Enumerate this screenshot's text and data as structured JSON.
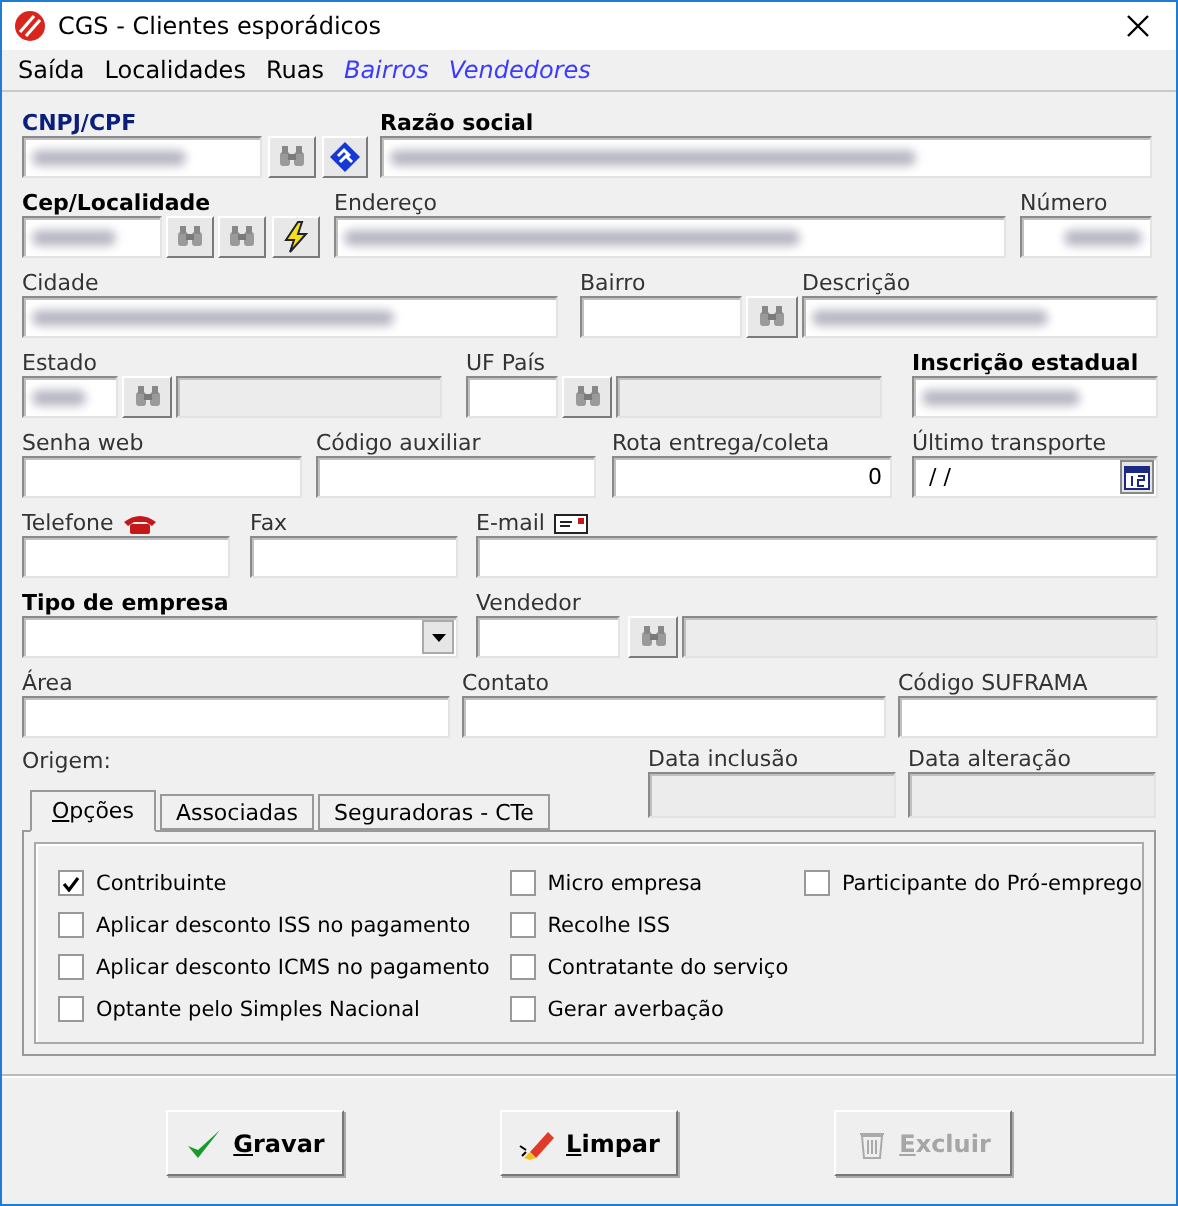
{
  "window": {
    "title": "CGS - Clientes esporádicos"
  },
  "menu": [
    {
      "label": "Saída",
      "kind": "menu"
    },
    {
      "label": "Localidades",
      "kind": "menu"
    },
    {
      "label": "Ruas",
      "kind": "menu"
    },
    {
      "label": "Bairros",
      "kind": "link"
    },
    {
      "label": "Vendedores",
      "kind": "link"
    }
  ],
  "rows": [
    [
      {
        "kind": "field",
        "label": "CNPJ/CPF",
        "bold": true,
        "highlighted": true,
        "blurred": true
      },
      {
        "kind": "lookup"
      },
      {
        "kind": "web"
      },
      {
        "kind": "field",
        "label": "Razão social",
        "bold": true,
        "blurred": true
      }
    ],
    [
      {
        "kind": "field",
        "label": "Cep/Localidade",
        "bold": true,
        "blurred": true
      },
      {
        "kind": "lookup"
      },
      {
        "kind": "lookup"
      },
      {
        "kind": "lightning"
      },
      {
        "kind": "field",
        "label": "Endereço",
        "blurred": true
      },
      {
        "kind": "field",
        "label": "Número",
        "blurred": true,
        "right_aligned": true
      }
    ],
    [
      {
        "kind": "field",
        "label": "Cidade",
        "blurred": true
      },
      {
        "kind": "field",
        "label": "Bairro"
      },
      {
        "kind": "lookup"
      },
      {
        "kind": "field",
        "label": "Descrição",
        "blurred": true
      }
    ],
    [
      {
        "kind": "field",
        "label": "Estado",
        "blurred": true
      },
      {
        "kind": "lookup"
      },
      {
        "kind": "field",
        "disabled": true
      },
      {
        "kind": "field",
        "label": "UF País"
      },
      {
        "kind": "lookup"
      },
      {
        "kind": "field",
        "disabled": true
      },
      {
        "kind": "field",
        "label": "Inscrição estadual",
        "bold": true,
        "blurred": true
      }
    ],
    [
      {
        "kind": "field",
        "label": "Senha web"
      },
      {
        "kind": "field",
        "label": "Código auxiliar"
      },
      {
        "kind": "field",
        "label": "Rota entrega/coleta",
        "value": "0",
        "right_aligned": true
      },
      {
        "kind": "date",
        "label": "Último transporte",
        "value": " / /"
      }
    ],
    [
      {
        "kind": "field",
        "label": "Telefone"
      },
      {
        "kind": "field",
        "label": "Fax"
      },
      {
        "kind": "field",
        "label": "E-mail"
      }
    ],
    [
      {
        "kind": "combo",
        "label": "Tipo de empresa",
        "bold": true
      },
      {
        "kind": "field",
        "label": "Vendedor"
      },
      {
        "kind": "lookup"
      },
      {
        "kind": "field",
        "disabled": true
      }
    ],
    [
      {
        "kind": "field",
        "label": "Área"
      },
      {
        "kind": "field",
        "label": "Contato"
      },
      {
        "kind": "field",
        "label": "Código SUFRAMA"
      }
    ]
  ],
  "origin_label": "Origem:",
  "dates": [
    {
      "label": "Data inclusão",
      "disabled": true
    },
    {
      "label": "Data alteração",
      "disabled": true
    }
  ],
  "tabs": [
    {
      "label": "Opções",
      "selected": true,
      "mnemonic": true
    },
    {
      "label": "Associadas",
      "selected": false,
      "mnemonic": false
    },
    {
      "label": "Seguradoras - CTe",
      "selected": false,
      "mnemonic": false
    }
  ],
  "options": [
    [
      {
        "label": "Contribuinte",
        "checked": true
      },
      {
        "label": "Aplicar desconto ISS no pagamento",
        "checked": false
      },
      {
        "label": "Aplicar desconto ICMS no pagamento",
        "checked": false
      },
      {
        "label": "Optante pelo Simples Nacional",
        "checked": false
      }
    ],
    [
      {
        "label": "Micro empresa",
        "checked": false
      },
      {
        "label": "Recolhe ISS",
        "checked": false
      },
      {
        "label": "Contratante do serviço",
        "checked": false
      },
      {
        "label": "Gerar averbação",
        "checked": false
      }
    ],
    [
      {
        "label": "Participante do Pró-emprego",
        "checked": false
      }
    ]
  ],
  "buttons": [
    {
      "label": "Gravar",
      "kind": "save",
      "disabled": false,
      "mnemonic": true
    },
    {
      "label": "Limpar",
      "kind": "clear",
      "disabled": false,
      "mnemonic": true
    },
    {
      "label": "Excluir",
      "kind": "delete",
      "disabled": true,
      "mnemonic": true
    }
  ]
}
